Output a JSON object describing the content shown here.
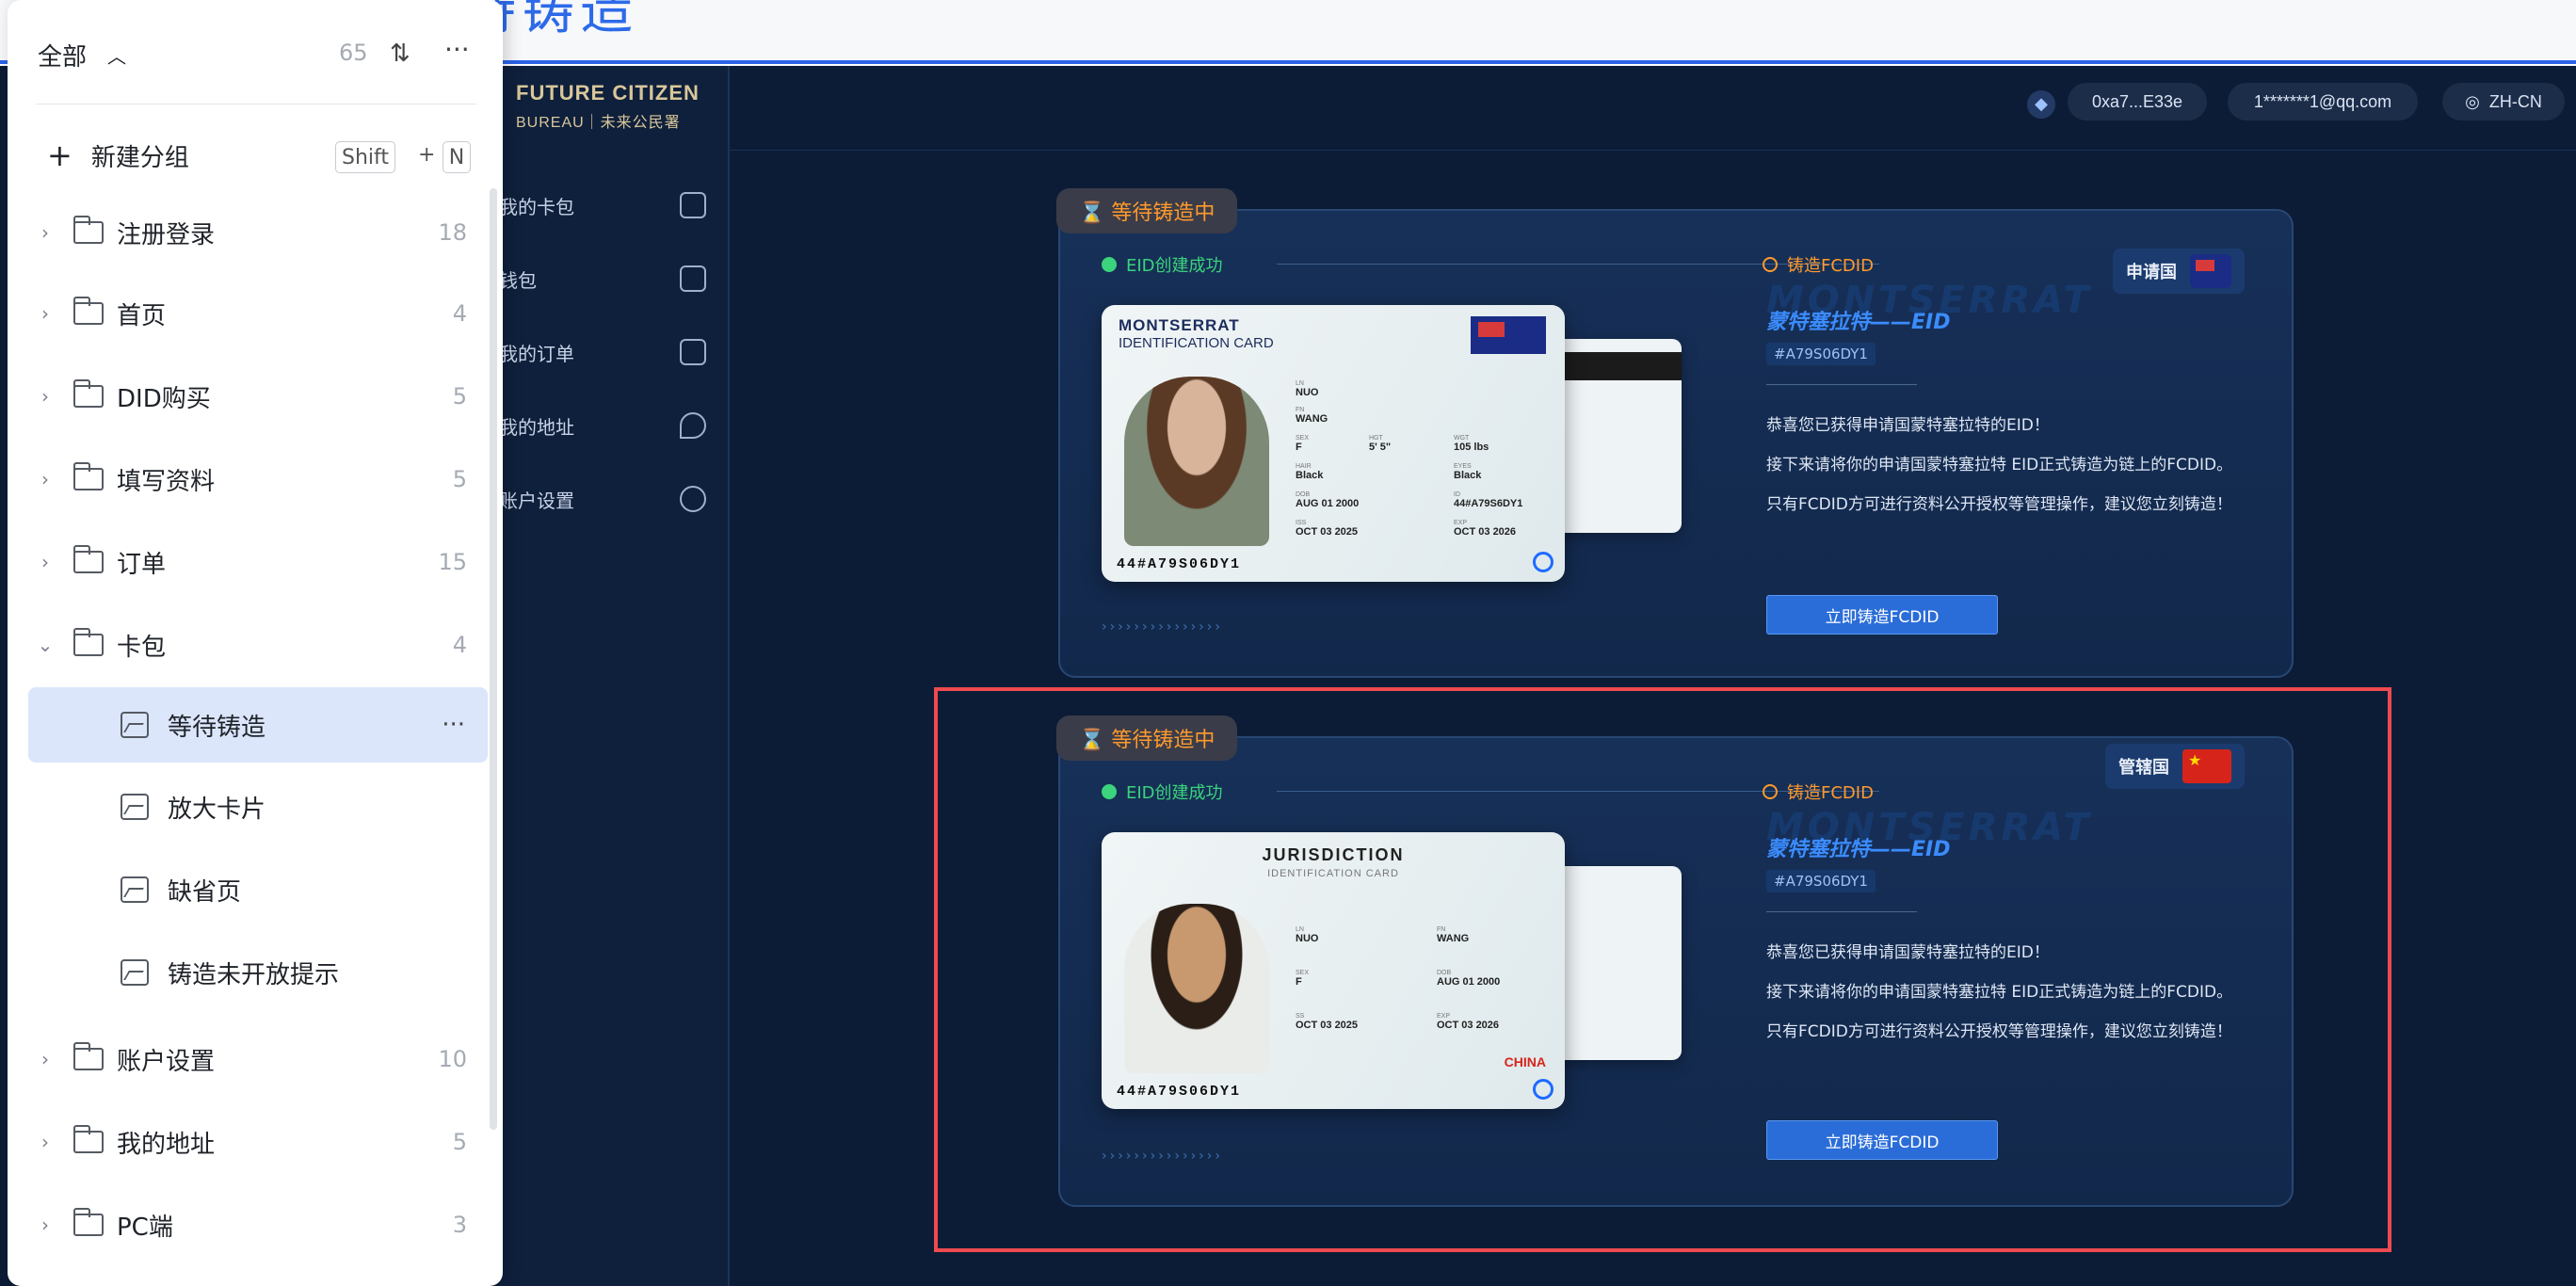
{
  "page": {
    "title_partial": "等待铸造"
  },
  "brand": {
    "line1": "FUTURE CITIZEN",
    "line2": "BUREAU｜未来公民署"
  },
  "sidenav": [
    "我的卡包",
    "钱包",
    "我的订单",
    "我的地址",
    "账户设置"
  ],
  "header": {
    "wallet": "0xa7...E33e",
    "email": "1*******1@qq.com",
    "language": "ZH-CN"
  },
  "cards": [
    {
      "status": "等待铸造中",
      "step_done": "EID创建成功",
      "step_pending": "铸造FCDID",
      "badge_label": "申请国",
      "id_title": "MONTSERRAT",
      "id_subtitle": "IDENTIFICATION CARD",
      "id_number": "44#A79S06DY1",
      "fields": {
        "ln": "NUO",
        "fn": "WANG",
        "sex": "F",
        "hgt": "5' 5\"",
        "wgt": "105 lbs",
        "hair": "Black",
        "eyes": "Black",
        "dob": "AUG 01 2000",
        "id": "44#A79S6DY1",
        "iss": "OCT 03 2025",
        "exp": "OCT 03 2026"
      },
      "eid_title": "蒙特塞拉特——EID",
      "eid_code": "#A79S06DY1",
      "desc": [
        "恭喜您已获得申请国蒙特塞拉特的EID！",
        "接下来请将你的申请国蒙特塞拉特 EID正式铸造为链上的FCDID。",
        "只有FCDID方可进行资料公开授权等管理操作，建议您立刻铸造！"
      ],
      "button": "立即铸造FCDID"
    },
    {
      "status": "等待铸造中",
      "step_done": "EID创建成功",
      "step_pending": "铸造FCDID",
      "badge_label": "管辖国",
      "id_title": "JURISDICTION",
      "id_subtitle": "IDENTIFICATION CARD",
      "id_number": "44#A79S06DY1",
      "country_text": "CHINA",
      "fields": {
        "ln": "NUO",
        "fn": "WANG",
        "sex": "F",
        "dob": "AUG 01 2000",
        "iss": "OCT 03 2025",
        "exp": "OCT 03 2026"
      },
      "eid_title": "蒙特塞拉特——EID",
      "eid_code": "#A79S06DY1",
      "desc": [
        "恭喜您已获得申请国蒙特塞拉特的EID！",
        "接下来请将你的申请国蒙特塞拉特 EID正式铸造为链上的FCDID。",
        "只有FCDID方可进行资料公开授权等管理操作，建议您立刻铸造！"
      ],
      "button": "立即铸造FCDID"
    }
  ],
  "tree": {
    "header": "全部",
    "total": "65",
    "new_group": "新建分组",
    "shortcut": [
      "Shift",
      "+",
      "N"
    ],
    "items": [
      {
        "label": "注册登录",
        "count": "18"
      },
      {
        "label": "首页",
        "count": "4"
      },
      {
        "label": "DID购买",
        "count": "5"
      },
      {
        "label": "填写资料",
        "count": "5"
      },
      {
        "label": "订单",
        "count": "15"
      },
      {
        "label": "卡包",
        "count": "4"
      }
    ],
    "sub_items": [
      "等待铸造",
      "放大卡片",
      "缺省页",
      "铸造未开放提示"
    ],
    "items_after": [
      {
        "label": "账户设置",
        "count": "10"
      },
      {
        "label": "我的地址",
        "count": "5"
      },
      {
        "label": "PC端",
        "count": "3"
      }
    ]
  },
  "colors": {
    "accent": "#2b6dd8",
    "status": "#ff9a2c",
    "success": "#3bd37c",
    "highlight": "#ee4a50"
  }
}
